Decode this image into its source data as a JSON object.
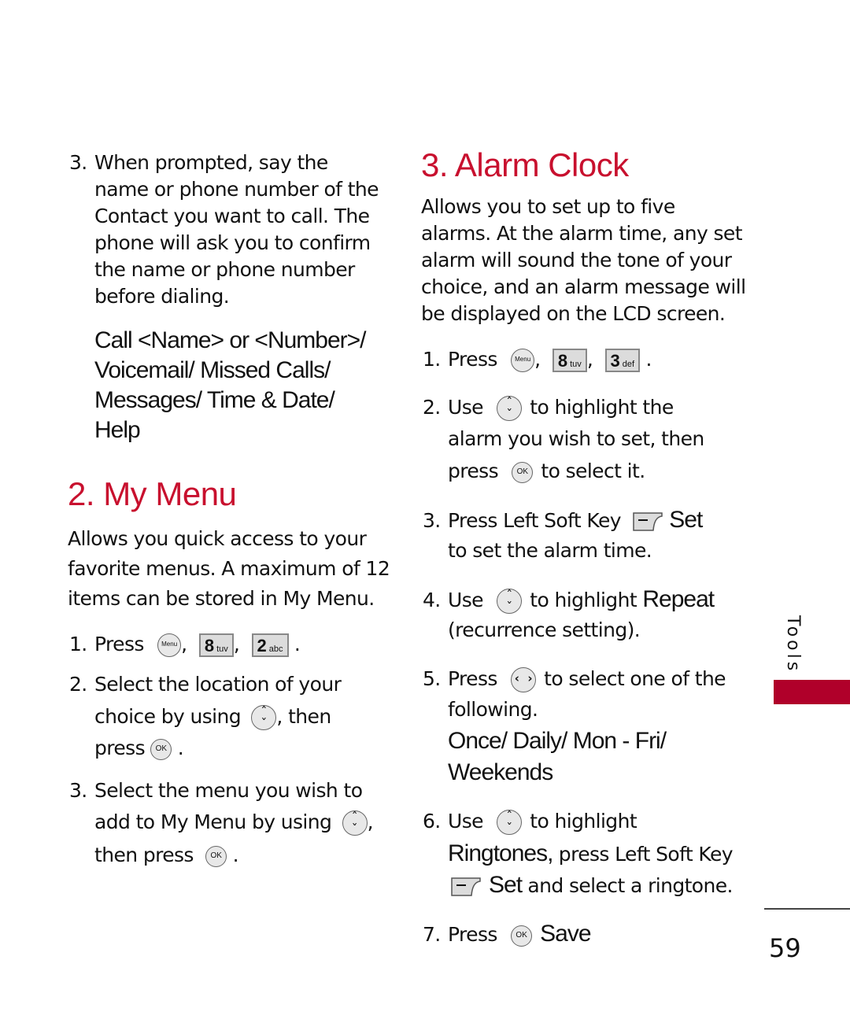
{
  "left_column": {
    "voice_step": {
      "number": "3.",
      "lines": [
        "When prompted, say the",
        "name or phone number of the",
        "Contact you want to call. The",
        "phone will ask you to confirm",
        "the name or phone number",
        "before dialing."
      ]
    },
    "voice_options": {
      "lines": [
        "Call <Name> or <Number>/",
        "Voicemail/ Missed Calls/",
        "Messages/ Time & Date/",
        "Help"
      ]
    },
    "my_menu": {
      "heading": "2. My Menu",
      "description": [
        "Allows you quick access to your",
        "favorite menus. A maximum of 12",
        "items can be stored in My Menu."
      ],
      "steps": [
        {
          "number": "1.",
          "text": "Press",
          "keys": [
            "Menu",
            "8 tuv",
            "2 abc"
          ]
        },
        {
          "number": "2.",
          "lines": [
            "Select the location of your",
            "choice by using",
            ", then",
            "press",
            "."
          ]
        },
        {
          "number": "3.",
          "lines": [
            "Select the menu you wish to",
            "add to My Menu by using",
            ",",
            "then press",
            "."
          ]
        }
      ]
    }
  },
  "right_column": {
    "alarm_clock": {
      "heading": "3. Alarm Clock",
      "description": [
        "Allows you to set up to five",
        "alarms. At the alarm time, any set",
        "alarm will sound the tone of your",
        "choice, and an alarm message will",
        "be displayed on the LCD screen."
      ],
      "steps": {
        "s1": {
          "number": "1.",
          "text": "Press",
          "key1_num": "8",
          "key1_letters": "tuv",
          "key2_num": "3",
          "key2_letters": "def"
        },
        "s2": {
          "number": "2.",
          "a": "Use",
          "b": "to highlight the",
          "c": "alarm you wish to set, then",
          "d": "press",
          "e": "to select it."
        },
        "s3": {
          "number": "3.",
          "a": "Press Left Soft Key",
          "term": "Set",
          "b": "to set the alarm time."
        },
        "s4": {
          "number": "4.",
          "a": "Use",
          "b": "to highlight",
          "term": "Repeat",
          "c": "(recurrence setting)."
        },
        "s5": {
          "number": "5.",
          "a": "Press",
          "b": "to select one of the",
          "c": "following.",
          "options1": "Once/ Daily/ Mon - Fri/",
          "options2": "Weekends"
        },
        "s6": {
          "number": "6.",
          "a": "Use",
          "b": "to highlight",
          "term": "Ringtones,",
          "c": "press Left Soft Key",
          "term2": "Set",
          "d": "and select a ringtone."
        },
        "s7": {
          "number": "7.",
          "a": "Press",
          "term": "Save"
        }
      }
    }
  },
  "sidebar": {
    "section_label": "Tools",
    "accent_color": "#b0002a"
  },
  "footer": {
    "page_number": "59"
  },
  "left_keys": {
    "k1_num": "8",
    "k1_letters": "tuv",
    "k2_num": "2",
    "k2_letters": "abc"
  },
  "punct": {
    "comma": ",",
    "period": "."
  }
}
